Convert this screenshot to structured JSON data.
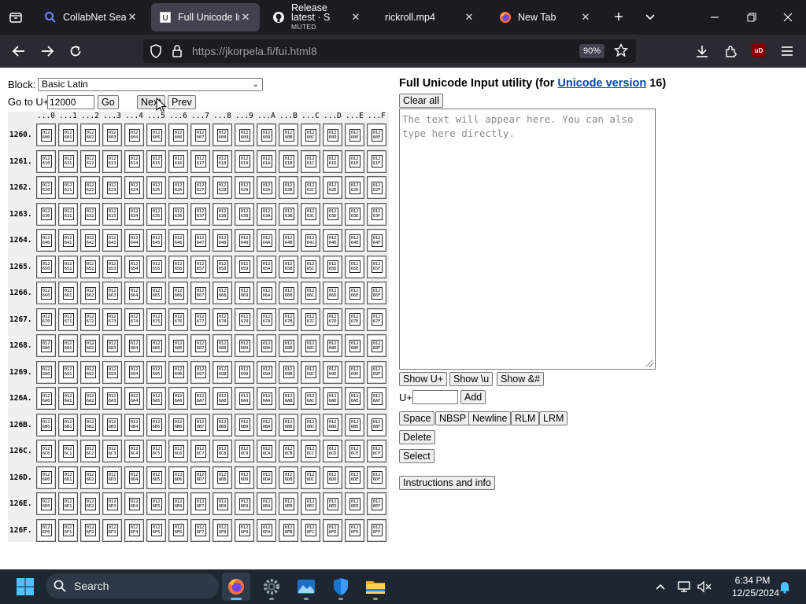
{
  "browser": {
    "tabs": [
      {
        "title": "CollabNet SearX",
        "icon": "magnifier-icon",
        "active": false
      },
      {
        "title": "Full Unicode Inp",
        "icon": "unicode-page-icon",
        "active": true
      },
      {
        "title": "Release latest · S",
        "subtitle": "MUTED",
        "icon": "github-icon",
        "active": false
      },
      {
        "title": "rickroll.mp4",
        "icon": "none",
        "active": false
      },
      {
        "title": "New Tab",
        "icon": "firefox-icon",
        "active": false
      }
    ],
    "url": "https://jkorpela.fi/fui.html8",
    "zoom": "90%",
    "ublock_label": "uD"
  },
  "page": {
    "block_label": "Block:",
    "block_selected": "Basic Latin",
    "goto_label": "Go to U+",
    "goto_value": "12000",
    "go_button": "Go",
    "next_button": "Next",
    "prev_button": "Prev",
    "grid": {
      "columns": [
        "...0",
        "...1",
        "...2",
        "...3",
        "...4",
        "...5",
        "...6",
        "...7",
        "...8",
        "...9",
        "...A",
        "...B",
        "...C",
        "...D",
        "...E",
        "...F"
      ],
      "rows": [
        "1260.",
        "1261.",
        "1262.",
        "1263.",
        "1264.",
        "1265.",
        "1266.",
        "1267.",
        "1268.",
        "1269.",
        "126A.",
        "126B.",
        "126C.",
        "126D.",
        "126E.",
        "126F."
      ],
      "glyph_prefix": "012"
    },
    "util_title_prefix": "Full Unicode Input utility (for ",
    "util_title_link": "Unicode version",
    "util_title_suffix": " 16)",
    "clear_all": "Clear all",
    "textarea_placeholder": "The text will appear here. You can also type here directly.",
    "show_u": "Show U+",
    "show_backslash_u": "Show \\u",
    "show_entity": "Show &#",
    "uplus_label": "U+",
    "add_button": "Add",
    "space_button": "Space",
    "nbsp_button": "NBSP",
    "newline_button": "Newline",
    "rlm_button": "RLM",
    "lrm_button": "LRM",
    "delete_button": "Delete",
    "select_button": "Select",
    "instructions_button": "Instructions and info"
  },
  "taskbar": {
    "search_label": "Search",
    "time": "6:34 PM",
    "date": "12/25/2024"
  },
  "colors": {
    "chrome_dark": "#1c1b22",
    "toolbar": "#2b2a33",
    "link": "#0645ad",
    "taskbar": "#1d2631"
  }
}
